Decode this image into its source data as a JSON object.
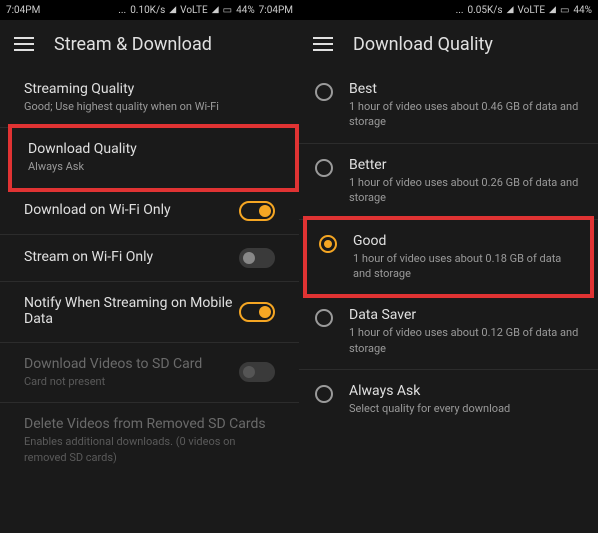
{
  "left": {
    "status": {
      "time_left": "7:04PM",
      "speed": "0.10K/s",
      "network": "VoLTE",
      "battery": "44%",
      "time_right": "7:04PM"
    },
    "title": "Stream & Download",
    "items": [
      {
        "title": "Streaming Quality",
        "subtitle": "Good; Use highest quality when on Wi-Fi"
      },
      {
        "title": "Download Quality",
        "subtitle": "Always Ask"
      },
      {
        "title": "Download on Wi-Fi Only",
        "subtitle": ""
      },
      {
        "title": "Stream on Wi-Fi Only",
        "subtitle": ""
      },
      {
        "title": "Notify When Streaming on Mobile Data",
        "subtitle": ""
      },
      {
        "title": "Download Videos to SD Card",
        "subtitle": "Card not present"
      },
      {
        "title": "Delete Videos from Removed SD Cards",
        "subtitle": "Enables additional downloads. (0 videos on removed SD cards)"
      }
    ]
  },
  "right": {
    "status": {
      "speed": "0.05K/s",
      "network": "VoLTE",
      "battery": "44%"
    },
    "title": "Download Quality",
    "options": [
      {
        "title": "Best",
        "subtitle": "1 hour of video uses about 0.46 GB of data and storage"
      },
      {
        "title": "Better",
        "subtitle": "1 hour of video uses about 0.26 GB of data and storage"
      },
      {
        "title": "Good",
        "subtitle": "1 hour of video uses about 0.18 GB of data and storage"
      },
      {
        "title": "Data Saver",
        "subtitle": "1 hour of video uses about 0.12 GB of data and storage"
      },
      {
        "title": "Always Ask",
        "subtitle": "Select quality for every download"
      }
    ]
  }
}
